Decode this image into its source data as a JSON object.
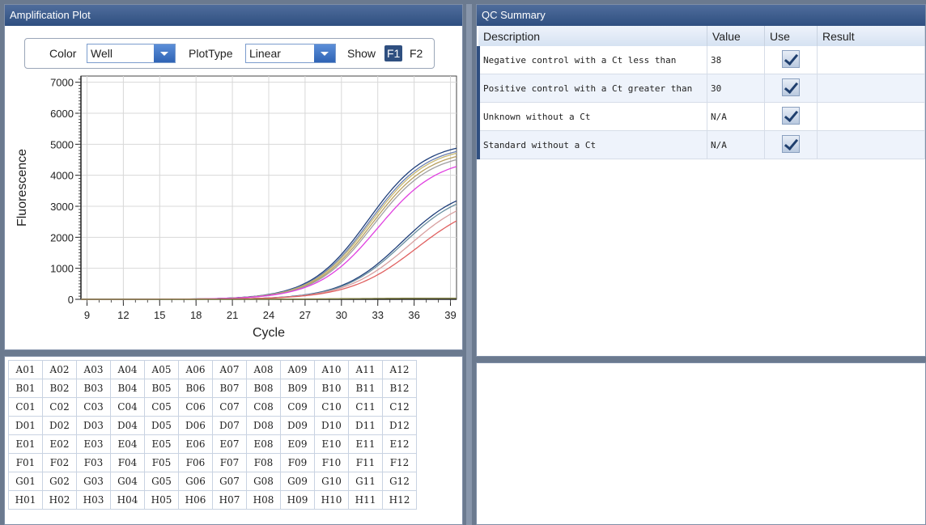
{
  "amplification": {
    "title": "Amplification Plot",
    "color_label": "Color",
    "color_value": "Well",
    "plottype_label": "PlotType",
    "plottype_value": "Linear",
    "show_label": "Show",
    "f1": "F1",
    "f2": "F2"
  },
  "chart_data": {
    "type": "line",
    "xlabel": "Cycle",
    "ylabel": "Fluorescence",
    "x_ticks": [
      9,
      12,
      15,
      18,
      21,
      24,
      27,
      30,
      33,
      36,
      39
    ],
    "y_ticks": [
      0,
      1000,
      2000,
      3000,
      4000,
      5000,
      6000,
      7000
    ],
    "xlim": [
      8.5,
      39.5
    ],
    "ylim": [
      0,
      7200
    ],
    "grid": true,
    "series": [
      {
        "color": "#1f3f7a",
        "plateau": 5100,
        "midpoint": 32.2,
        "slope": 0.42
      },
      {
        "color": "#6a7fb0",
        "plateau": 5000,
        "midpoint": 32.3,
        "slope": 0.42
      },
      {
        "color": "#c8b870",
        "plateau": 4950,
        "midpoint": 32.4,
        "slope": 0.42
      },
      {
        "color": "#b8a060",
        "plateau": 4850,
        "midpoint": 32.5,
        "slope": 0.42
      },
      {
        "color": "#a0a0a0",
        "plateau": 4750,
        "midpoint": 32.6,
        "slope": 0.42
      },
      {
        "color": "#e040e0",
        "plateau": 4600,
        "midpoint": 33.0,
        "slope": 0.4
      },
      {
        "color": "#1f3f7a",
        "plateau": 3700,
        "midpoint": 35.0,
        "slope": 0.4
      },
      {
        "color": "#6a8fa0",
        "plateau": 3600,
        "midpoint": 35.1,
        "slope": 0.4
      },
      {
        "color": "#d8a0a0",
        "plateau": 3500,
        "midpoint": 35.6,
        "slope": 0.38
      },
      {
        "color": "#e06060",
        "plateau": 3300,
        "midpoint": 36.2,
        "slope": 0.36
      },
      {
        "color": "#808040",
        "plateau": 40,
        "midpoint": 30.0,
        "slope": 0.3
      }
    ]
  },
  "qc": {
    "title": "QC Summary",
    "headers": [
      "Description",
      "Value",
      "Use",
      "Result"
    ],
    "rows": [
      {
        "description": "Negative control with a Ct less than",
        "value": "38"
      },
      {
        "description": "Positive control with a Ct greater than",
        "value": "30"
      },
      {
        "description": "Unknown without a Ct",
        "value": "N/A"
      },
      {
        "description": "Standard without a Ct",
        "value": "N/A"
      }
    ]
  },
  "wells": {
    "rows": [
      "A",
      "B",
      "C",
      "D",
      "E",
      "F",
      "G",
      "H"
    ],
    "cols": [
      "01",
      "02",
      "03",
      "04",
      "05",
      "06",
      "07",
      "08",
      "09",
      "10",
      "11",
      "12"
    ]
  }
}
